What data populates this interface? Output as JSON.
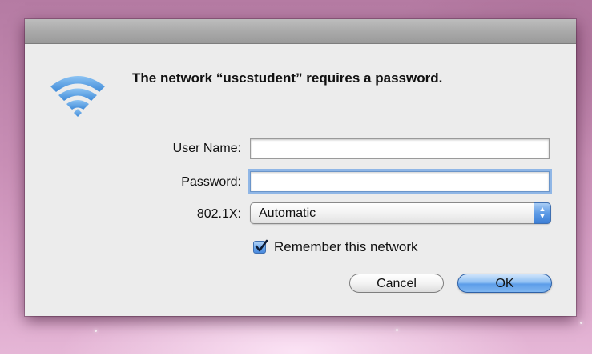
{
  "dialog": {
    "icon": "wifi-icon",
    "message": "The network “uscstudent” requires a password.",
    "fields": {
      "username_label": "User Name:",
      "username_value": "",
      "password_label": "Password:",
      "password_value": "",
      "security_label": "802.1X:",
      "security_selected": "Automatic"
    },
    "remember": {
      "label": "Remember this network",
      "checked": true
    },
    "buttons": {
      "cancel": "Cancel",
      "ok": "OK"
    }
  },
  "colors": {
    "accent": "#5c9de9",
    "wifi_icon": "#5fa6e8",
    "dialog_bg": "#ececec"
  }
}
